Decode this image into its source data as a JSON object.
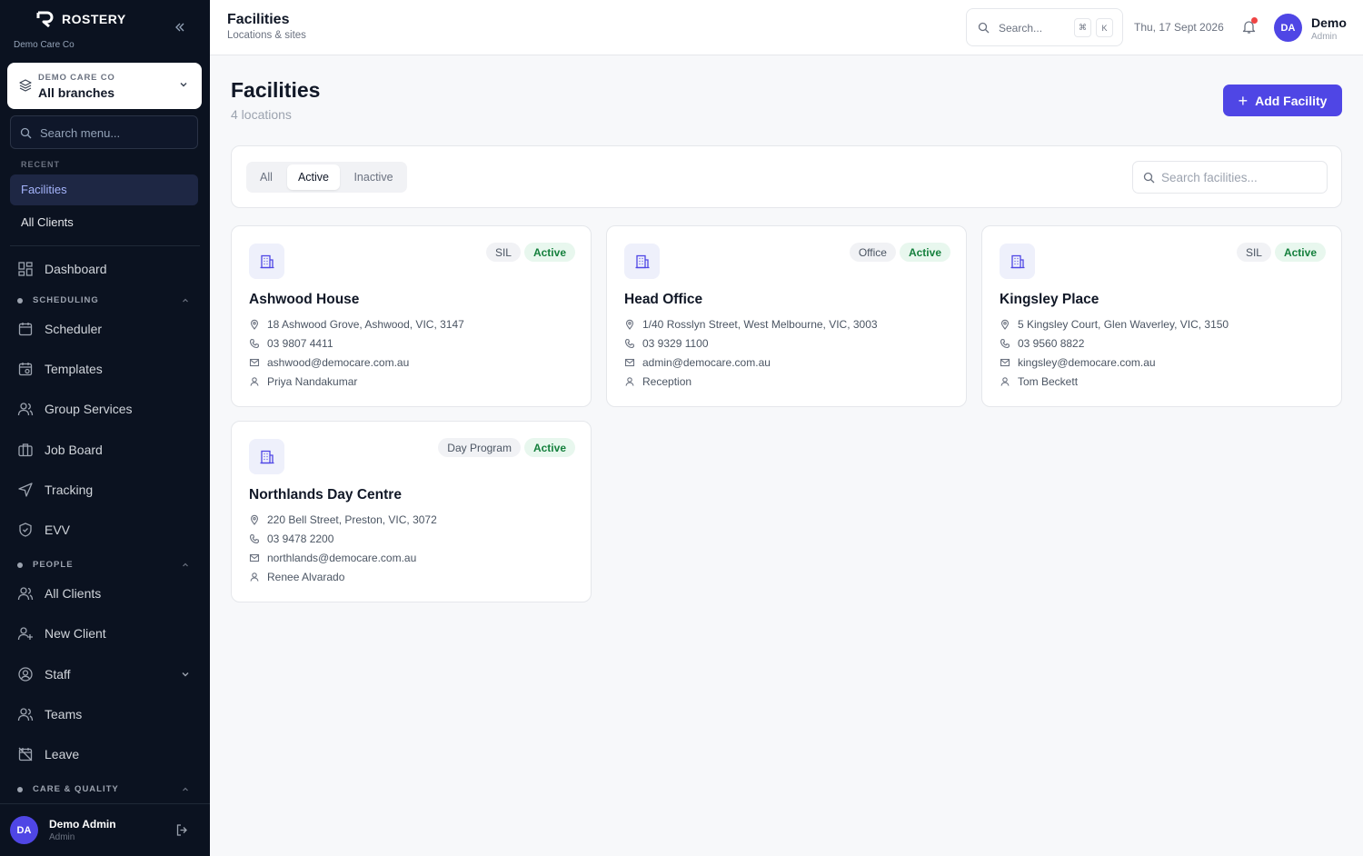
{
  "sidebar": {
    "brand": "ROSTERY",
    "org_name": "Demo Care Co",
    "branch_picker": {
      "org": "DEMO CARE CO",
      "value": "All branches"
    },
    "search_placeholder": "Search menu...",
    "recent_label": "RECENT",
    "recent": [
      {
        "label": "Facilities",
        "active": true
      },
      {
        "label": "All Clients",
        "active": false
      }
    ],
    "dashboard": "Dashboard",
    "groups": {
      "scheduling": "SCHEDULING",
      "people": "PEOPLE",
      "care_quality": "CARE & QUALITY"
    },
    "scheduling_items": [
      {
        "label": "Scheduler",
        "icon": "calendar-icon"
      },
      {
        "label": "Templates",
        "icon": "calendar-template-icon"
      },
      {
        "label": "Group Services",
        "icon": "users-icon"
      },
      {
        "label": "Job Board",
        "icon": "briefcase-icon"
      },
      {
        "label": "Tracking",
        "icon": "navigation-icon"
      },
      {
        "label": "EVV",
        "icon": "shield-check-icon"
      }
    ],
    "people_items": [
      {
        "label": "All Clients",
        "icon": "users-icon"
      },
      {
        "label": "New Client",
        "icon": "user-plus-icon"
      },
      {
        "label": "Staff",
        "icon": "user-circle-icon"
      },
      {
        "label": "Teams",
        "icon": "team-icon"
      },
      {
        "label": "Leave",
        "icon": "calendar-off-icon"
      }
    ],
    "user": {
      "initials": "DA",
      "name": "Demo Admin",
      "role": "Admin"
    }
  },
  "topbar": {
    "title": "Facilities",
    "subtitle": "Locations & sites",
    "search_placeholder": "Search...",
    "kbd_cmd": "⌘",
    "kbd_k": "K",
    "date": "Thu, 17 Sept 2026",
    "user": {
      "initials": "DA",
      "name": "Demo",
      "role": "Admin"
    }
  },
  "main": {
    "title": "Facilities",
    "count": "4 locations",
    "add_button": "Add Facility",
    "filters": {
      "all": "All",
      "active": "Active",
      "inactive": "Inactive",
      "selected": "Active"
    },
    "search_placeholder": "Search facilities...",
    "facilities": [
      {
        "name": "Ashwood House",
        "type": "SIL",
        "status": "Active",
        "address": "18 Ashwood Grove, Ashwood, VIC, 3147",
        "phone": "03 9807 4411",
        "email": "ashwood@democare.com.au",
        "contact": "Priya Nandakumar"
      },
      {
        "name": "Head Office",
        "type": "Office",
        "status": "Active",
        "address": "1/40 Rosslyn Street, West Melbourne, VIC, 3003",
        "phone": "03 9329 1100",
        "email": "admin@democare.com.au",
        "contact": "Reception"
      },
      {
        "name": "Kingsley Place",
        "type": "SIL",
        "status": "Active",
        "address": "5 Kingsley Court, Glen Waverley, VIC, 3150",
        "phone": "03 9560 8822",
        "email": "kingsley@democare.com.au",
        "contact": "Tom Beckett"
      },
      {
        "name": "Northlands Day Centre",
        "type": "Day Program",
        "status": "Active",
        "address": "220 Bell Street, Preston, VIC, 3072",
        "phone": "03 9478 2200",
        "email": "northlands@democare.com.au",
        "contact": "Renee Alvarado"
      }
    ]
  },
  "colors": {
    "sidebar_bg": "#0b1220",
    "accent": "#4f46e5",
    "status_active": "#15803d",
    "notification": "#ef4444"
  }
}
